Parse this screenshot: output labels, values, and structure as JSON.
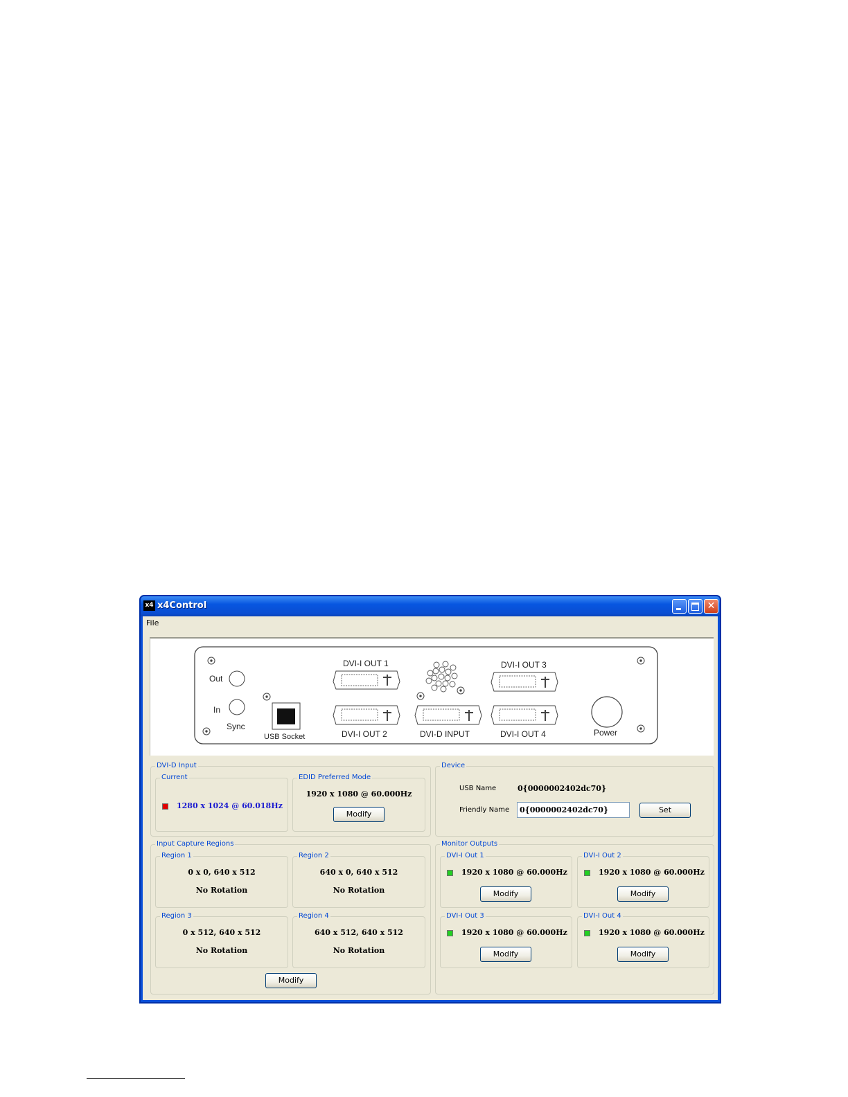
{
  "window": {
    "app_icon_text": "x4",
    "title": "x4Control",
    "close_glyph": "✕"
  },
  "menu": {
    "file": "File"
  },
  "device_panel": {
    "dvi_out_1": "DVI-I OUT 1",
    "dvi_out_2": "DVI-I OUT 2",
    "dvi_out_3": "DVI-I OUT 3",
    "dvi_out_4": "DVI-I OUT 4",
    "dvi_d_input": "DVI-D INPUT",
    "usb_socket": "USB Socket",
    "power": "Power",
    "sync_out": "Out",
    "sync_in": "In",
    "sync": "Sync"
  },
  "dvi_input": {
    "group_label": "DVI-D Input",
    "current": {
      "label": "Current",
      "status_color": "#e00000",
      "mode": "1280 x 1024 @ 60.018Hz"
    },
    "edid": {
      "label": "EDID Preferred Mode",
      "mode": "1920 x 1080 @ 60.000Hz",
      "button": "Modify"
    }
  },
  "device": {
    "group_label": "Device",
    "usb_name_label": "USB Name",
    "usb_name_value": "0{0000002402dc70}",
    "friendly_name_label": "Friendly Name",
    "friendly_name_value": "0{0000002402dc70}",
    "set_button": "Set"
  },
  "capture_regions": {
    "group_label": "Input Capture Regions",
    "regions": [
      {
        "label": "Region 1",
        "geometry": "0 x 0, 640 x 512",
        "rotation": "No Rotation"
      },
      {
        "label": "Region 2",
        "geometry": "640 x 0, 640 x 512",
        "rotation": "No Rotation"
      },
      {
        "label": "Region 3",
        "geometry": "0 x 512, 640 x 512",
        "rotation": "No Rotation"
      },
      {
        "label": "Region 4",
        "geometry": "640 x 512, 640 x 512",
        "rotation": "No Rotation"
      }
    ],
    "button": "Modify"
  },
  "monitor_outputs": {
    "group_label": "Monitor Outputs",
    "outputs": [
      {
        "label": "DVI-I Out 1",
        "status_color": "#22d022",
        "mode": "1920 x 1080 @ 60.000Hz",
        "button": "Modify"
      },
      {
        "label": "DVI-I Out 2",
        "status_color": "#22d022",
        "mode": "1920 x 1080 @ 60.000Hz",
        "button": "Modify"
      },
      {
        "label": "DVI-I Out 3",
        "status_color": "#22d022",
        "mode": "1920 x 1080 @ 60.000Hz",
        "button": "Modify"
      },
      {
        "label": "DVI-I Out 4",
        "status_color": "#22d022",
        "mode": "1920 x 1080 @ 60.000Hz",
        "button": "Modify"
      }
    ]
  }
}
